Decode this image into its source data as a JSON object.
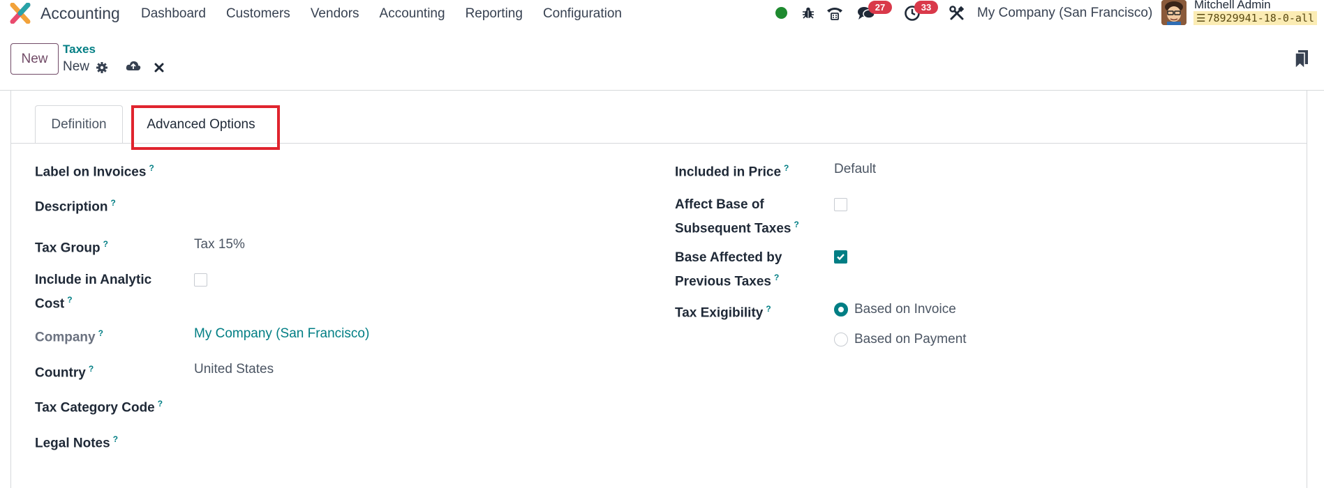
{
  "navbar": {
    "app_name": "Accounting",
    "menu": [
      "Dashboard",
      "Customers",
      "Vendors",
      "Accounting",
      "Reporting",
      "Configuration"
    ],
    "messages_count": "27",
    "activities_count": "33",
    "company": "My Company (San Francisco)",
    "user_name": "Mitchell Admin",
    "database": "78929941-18-0-all"
  },
  "control_panel": {
    "new_label": "New",
    "breadcrumb": "Taxes",
    "record_name": "New"
  },
  "tabs": {
    "definition": "Definition",
    "advanced": "Advanced Options"
  },
  "left_fields": {
    "label_on_invoices": "Label on Invoices",
    "description": "Description",
    "tax_group": "Tax Group",
    "tax_group_value": "Tax 15%",
    "include_analytic_1": "Include in Analytic",
    "include_analytic_2": "Cost",
    "company": "Company",
    "company_value": "My Company (San Francisco)",
    "country": "Country",
    "country_value": "United States",
    "tax_category_code": "Tax Category Code",
    "legal_notes": "Legal Notes"
  },
  "right_fields": {
    "included_in_price": "Included in Price",
    "included_in_price_value": "Default",
    "affect_base_1": "Affect Base of",
    "affect_base_2": "Subsequent Taxes",
    "base_affected_1": "Base Affected by",
    "base_affected_2": "Previous Taxes",
    "tax_exigibility": "Tax Exigibility",
    "exigibility_options": [
      "Based on Invoice",
      "Based on Payment"
    ]
  },
  "state": {
    "include_analytic_checked": false,
    "affect_base_checked": false,
    "base_affected_checked": true,
    "exigibility_selected": "Based on Invoice"
  },
  "colors": {
    "accent": "#017e84",
    "brand": "#714b67",
    "badge": "#d9394a",
    "highlight": "#e0242e"
  }
}
